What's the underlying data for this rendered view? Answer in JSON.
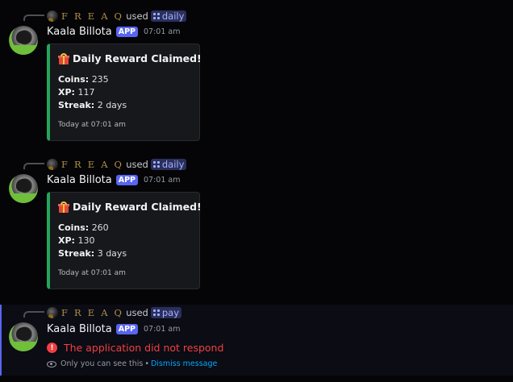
{
  "messages": [
    {
      "command_user": "F R E A Q",
      "used_text": "used",
      "command": "daily",
      "username": "Kaala Billota",
      "app_badge": "APP",
      "time": "07:01 am",
      "embed": {
        "title": "Daily Reward Claimed!",
        "coins_label": "Coins:",
        "coins_value": "235",
        "xp_label": "XP:",
        "xp_value": "117",
        "streak_label": "Streak:",
        "streak_value": "2 days",
        "footer": "Today at 07:01 am",
        "accent_color": "#23a559"
      }
    },
    {
      "command_user": "F R E A Q",
      "used_text": "used",
      "command": "daily",
      "username": "Kaala Billota",
      "app_badge": "APP",
      "time": "07:01 am",
      "embed": {
        "title": "Daily Reward Claimed!",
        "coins_label": "Coins:",
        "coins_value": "260",
        "xp_label": "XP:",
        "xp_value": "130",
        "streak_label": "Streak:",
        "streak_value": "3 days",
        "footer": "Today at 07:01 am",
        "accent_color": "#23a559"
      }
    },
    {
      "command_user": "F R E A Q",
      "used_text": "used",
      "command": "pay",
      "username": "Kaala Billota",
      "app_badge": "APP",
      "time": "07:01 am",
      "error_text": "The application did not respond",
      "ephemeral_text": "Only you can see this",
      "separator": "•",
      "dismiss_label": "Dismiss message"
    }
  ],
  "colors": {
    "background": "#050507",
    "brand": "#5865f2",
    "error": "#f23f43",
    "link": "#00a8fc"
  },
  "icons": [
    "slash-command-icon",
    "gift-icon",
    "error-icon",
    "eye-icon",
    "avatar"
  ]
}
